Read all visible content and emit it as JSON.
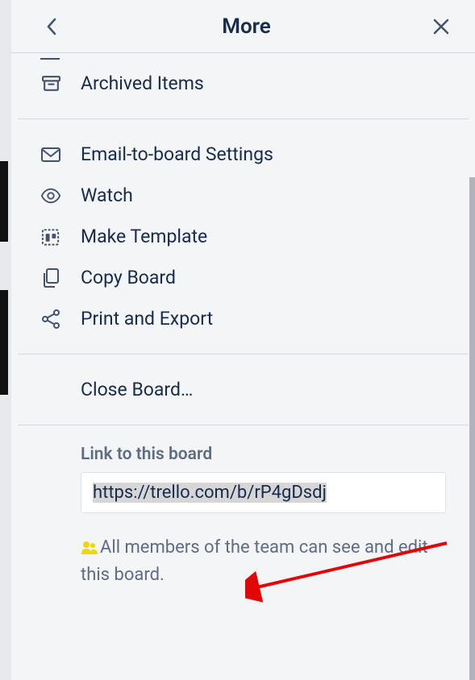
{
  "header": {
    "title": "More"
  },
  "menu": {
    "archived": "Archived Items",
    "email": "Email-to-board Settings",
    "watch": "Watch",
    "template": "Make Template",
    "copy": "Copy Board",
    "print": "Print and Export",
    "close": "Close Board…"
  },
  "link": {
    "label": "Link to this board",
    "url": "https://trello.com/b/rP4gDsdj"
  },
  "visibility": {
    "text": "All members of the team can see and edit this board."
  },
  "colors": {
    "accent_arrow": "#e20707",
    "team_icon": "#f2d600"
  }
}
